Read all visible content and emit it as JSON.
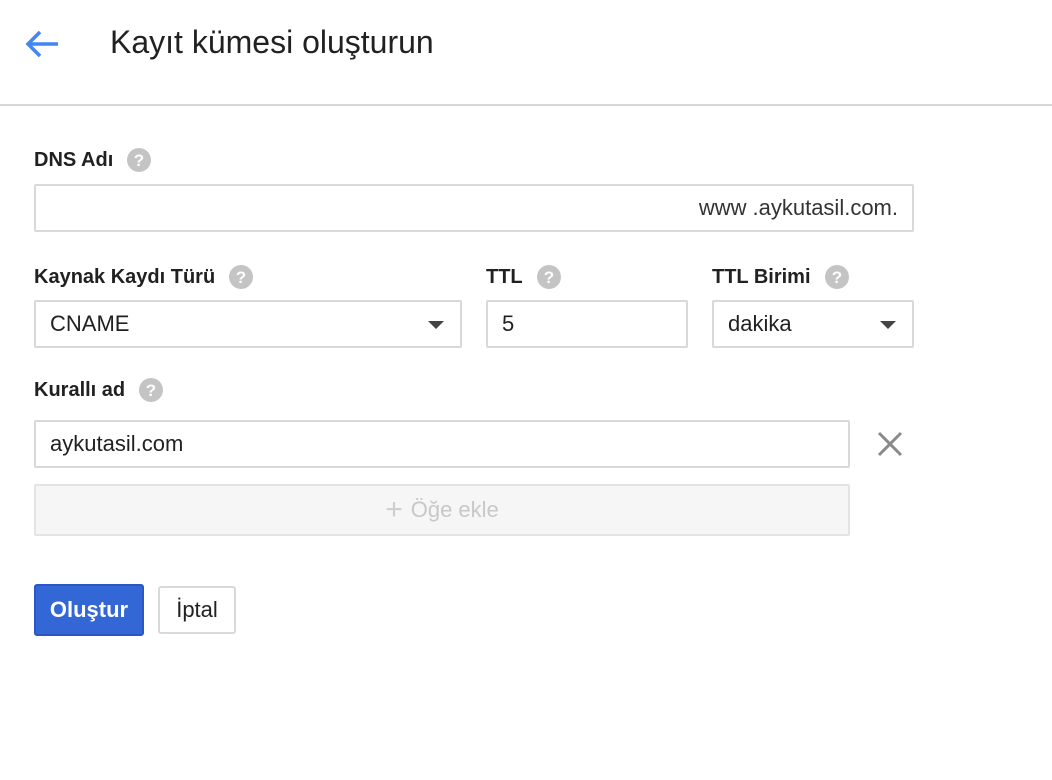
{
  "header": {
    "title": "Kayıt kümesi oluşturun",
    "back_icon": "arrow-back-icon"
  },
  "form": {
    "dns_name": {
      "label": "DNS Adı",
      "value": "",
      "prefix": "www",
      "suffix": ".aykutasil.com."
    },
    "record_type": {
      "label": "Kaynak Kaydı Türü",
      "value": "CNAME"
    },
    "ttl": {
      "label": "TTL",
      "value": "5"
    },
    "ttl_unit": {
      "label": "TTL Birimi",
      "value": "dakika"
    },
    "canonical_name": {
      "label": "Kurallı ad",
      "value": "aykutasil.com"
    },
    "add_item_label": "Öğe ekle"
  },
  "actions": {
    "create_label": "Oluştur",
    "cancel_label": "İptal"
  },
  "colors": {
    "accent": "#3367d6",
    "back_arrow": "#4285f4",
    "help_icon": "#c4c4c4"
  }
}
